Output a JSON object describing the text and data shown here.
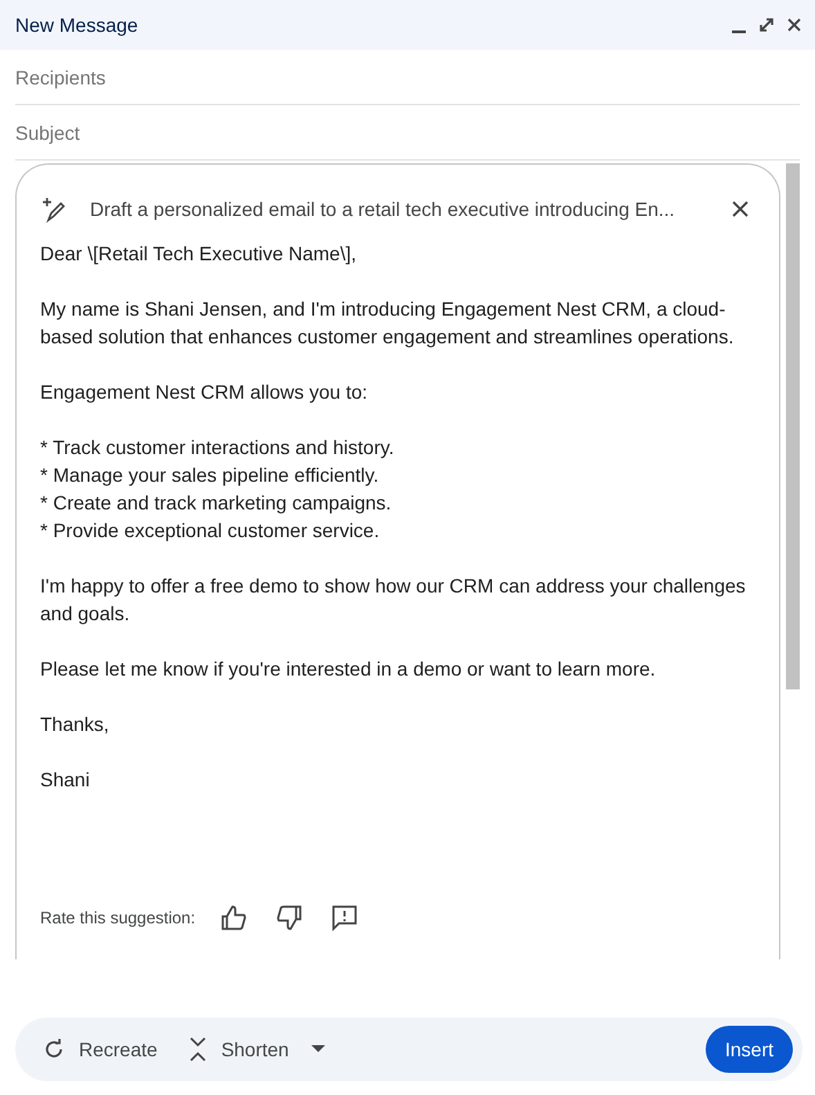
{
  "window": {
    "title": "New Message"
  },
  "fields": [
    {
      "placeholder": "Recipients"
    },
    {
      "placeholder": "Subject"
    }
  ],
  "suggestion": {
    "prompt": "Draft a personalized email to a retail tech executive introducing En...",
    "body": [
      [
        "Dear \\[Retail Tech Executive Name\\],"
      ],
      [
        "My name is Shani Jensen, and I'm introducing Engagement Nest CRM, a cloud-based solution that enhances customer engagement and streamlines operations."
      ],
      [
        "Engagement Nest CRM allows you to:"
      ],
      [
        "* Track customer interactions and history.",
        "* Manage your sales pipeline efficiently.",
        "* Create and track marketing campaigns.",
        "* Provide exceptional customer service."
      ],
      [
        "I'm happy to offer a free demo to show how our CRM can address your challenges and goals."
      ],
      [
        "Please let me know if you're interested in a demo or want to learn more."
      ],
      [
        "Thanks,"
      ],
      [
        "Shani"
      ]
    ],
    "rating_label": "Rate this suggestion:"
  },
  "actions": [
    {
      "label": "Recreate",
      "kind": "recreate"
    },
    {
      "label": "Shorten",
      "kind": "shorten"
    }
  ],
  "insert_button": "Insert"
}
